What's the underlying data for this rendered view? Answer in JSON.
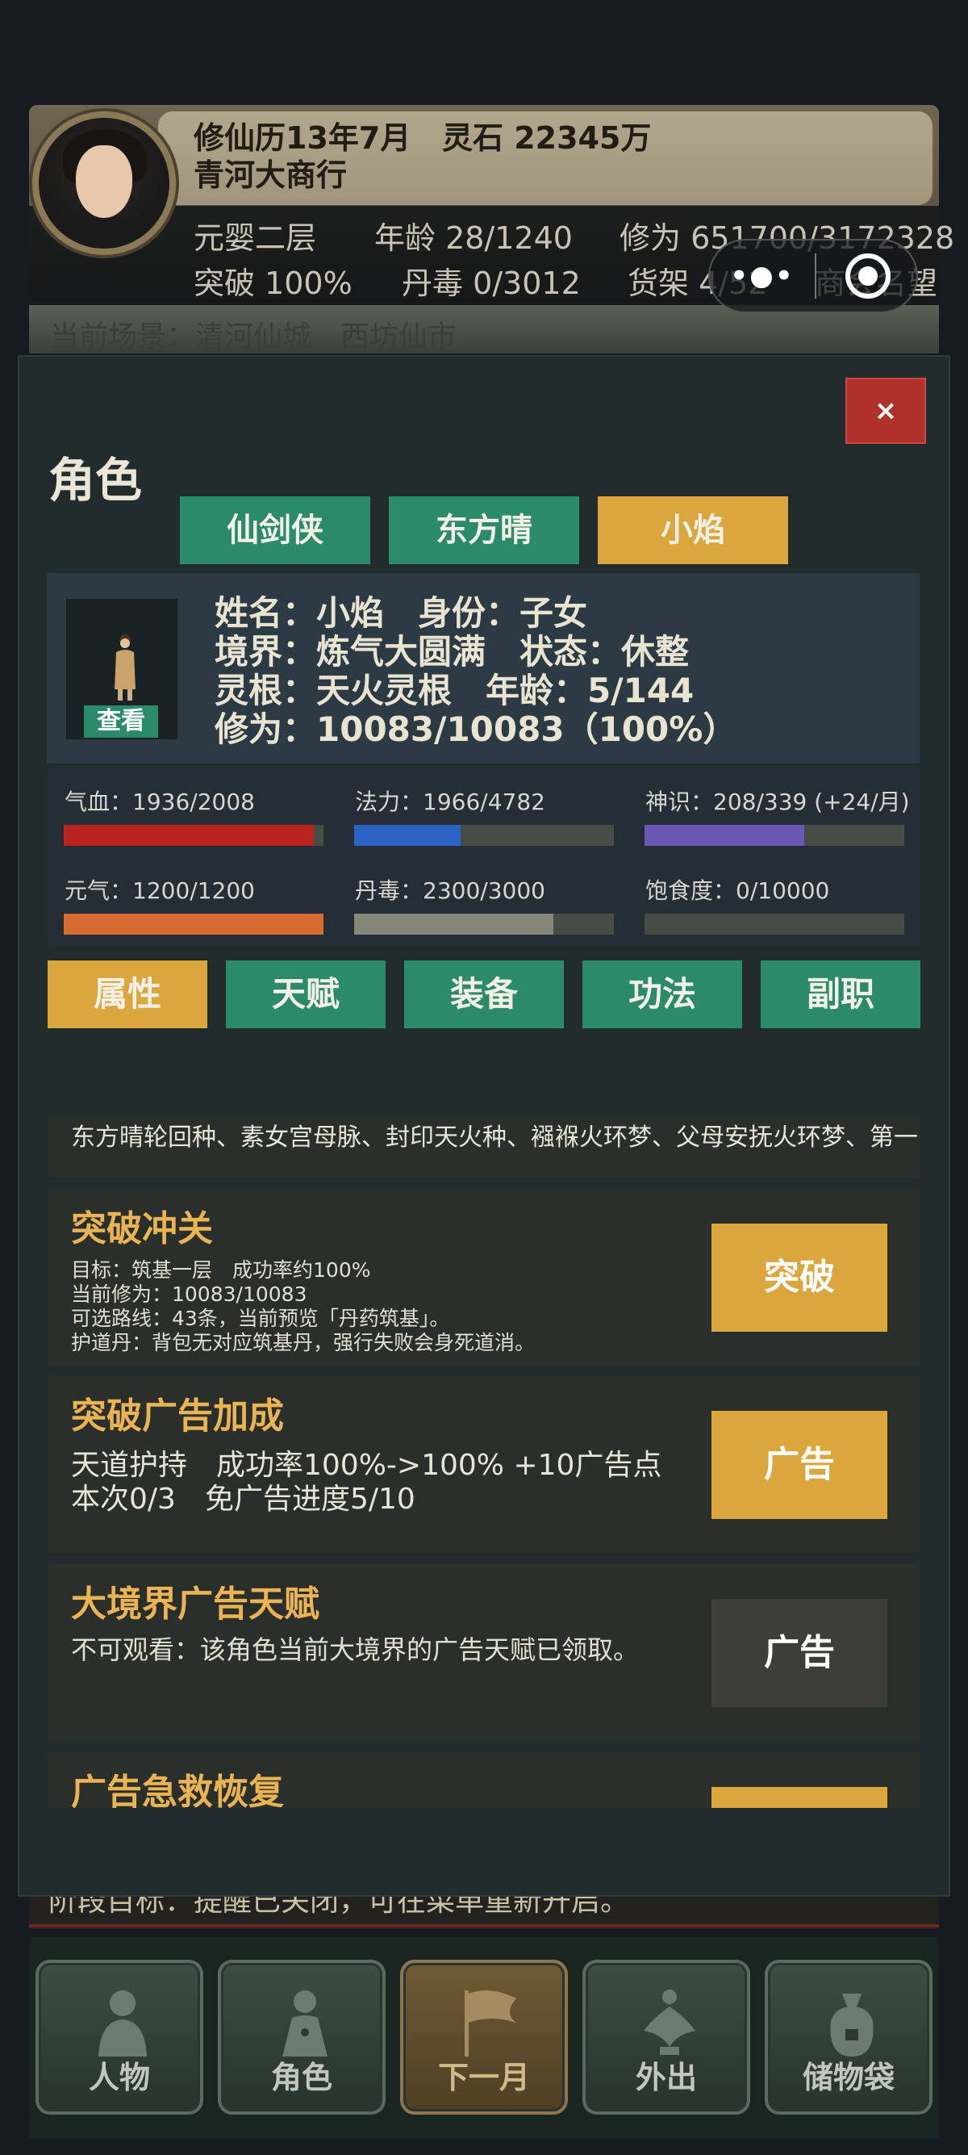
{
  "header": {
    "date": "修仙历13年7月",
    "spirit_stones": "灵石 22345万",
    "shop_name": "青河大商行",
    "realm": "元婴二层",
    "age": "年龄 28/1240",
    "cultivation": "修为 651700/3172328",
    "breakthrough": "突破 100%",
    "poison": "丹毒 0/3012",
    "shelf": "货架 4/52",
    "reputation": "商会名望",
    "capsule_more": "•●•",
    "scene": "当前场景：清河仙城　西坊仙市",
    "goal": "阶段目标：提醒已关闭，可在菜单重新开启。"
  },
  "modal": {
    "close": "×",
    "title": "角色",
    "char_tabs": [
      "仙剑侠",
      "东方晴",
      "小焰"
    ],
    "selected_char": 2,
    "info": {
      "view": "查看",
      "line1": "姓名：小焰　身份：子女",
      "line2": "境界：炼气大圆满　状态：休整",
      "line3": "灵根：天火灵根　年龄：5/144",
      "line4": "修为：10083/10083（100%）"
    },
    "stats": [
      {
        "label": "气血：1936/2008",
        "value": 0.964,
        "color": "#b8231d"
      },
      {
        "label": "法力：1966/4782",
        "value": 0.411,
        "color": "#2b62c4"
      },
      {
        "label": "神识：208/339 (+24/月)",
        "value": 0.614,
        "color": "#6a58b4"
      },
      {
        "label": "元气：1200/1200",
        "value": 1.0,
        "color": "#d86b32"
      },
      {
        "label": "丹毒：2300/3000",
        "value": 0.767,
        "color": "#878779"
      },
      {
        "label": "饱食度：0/10000",
        "value": 0.0,
        "color": "#6a6a60"
      }
    ],
    "attr_tabs": [
      "属性",
      "天赋",
      "装备",
      "功法",
      "副职"
    ],
    "selected_attr": 0,
    "talents": "东方晴轮回种、素女宫母脉、封印天火种、襁褓火环梦、父母安抚火环梦、第一",
    "cards": {
      "breakthrough": {
        "title": "突破冲关",
        "line1": "目标：筑基一层　成功率约100%",
        "line2": "当前修为：10083/10083",
        "line3": "可选路线：43条，当前预览「丹药筑基」。",
        "line4": "护道丹：背包无对应筑基丹，强行失败会身死道消。",
        "button": "突破"
      },
      "ad_boost": {
        "title": "突破广告加成",
        "line1": "天道护持　成功率100%->100% +10广告点",
        "line2": "本次0/3　免广告进度5/10",
        "button": "广告"
      },
      "realm_ad": {
        "title": "大境界广告天赋",
        "line1": "不可观看：该角色当前大境界的广告天赋已领取。",
        "button": "广告"
      },
      "rescue": {
        "title": "广告急救恢复"
      }
    }
  },
  "bottom_nav": [
    "人物",
    "角色",
    "下一月",
    "外出",
    "储物袋"
  ],
  "active_nav": 2
}
